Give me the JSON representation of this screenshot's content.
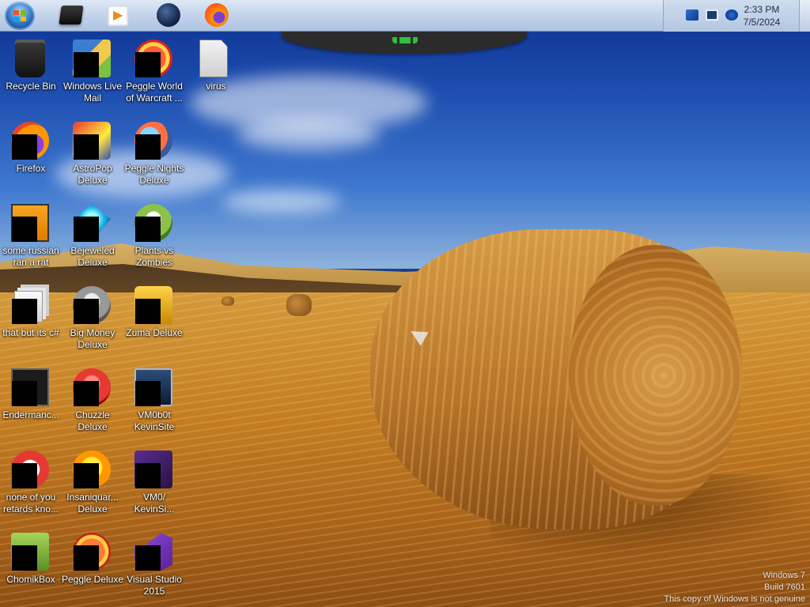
{
  "taskbar": {
    "pinned": [
      {
        "icon": "command-prompt-icon"
      },
      {
        "icon": "media-player-icon"
      },
      {
        "icon": "globe-browser-icon"
      },
      {
        "icon": "firefox-icon"
      }
    ],
    "tray_icons": [
      "action-center-flag-icon",
      "network-monitor-icon",
      "volume-icon"
    ],
    "clock": {
      "time": "2:33 PM",
      "date": "7/5/2024"
    }
  },
  "desktop": {
    "icons": [
      {
        "label": "Recycle Bin",
        "icon": "recycle-bin-icon"
      },
      {
        "label": "Windows Live Mail",
        "icon": "windows-live-mail-icon"
      },
      {
        "label": "Peggle World of Warcraft ...",
        "icon": "peggle-wow-icon"
      },
      {
        "label": "virus",
        "icon": "file-icon"
      },
      {
        "label": "Firefox",
        "icon": "firefox-icon"
      },
      {
        "label": "AstroPop Deluxe",
        "icon": "astropop-icon"
      },
      {
        "label": "Peggle Nights Deluxe",
        "icon": "peggle-nights-icon"
      },
      {
        "label": "some russian ran a rat",
        "icon": "program-icon"
      },
      {
        "label": "Bejeweled Deluxe",
        "icon": "bejeweled-icon"
      },
      {
        "label": "Plants vs Zombies",
        "icon": "plants-vs-zombies-icon"
      },
      {
        "label": "that but its c#",
        "icon": "files-icon"
      },
      {
        "label": "Big Money Deluxe",
        "icon": "big-money-icon"
      },
      {
        "label": "Zuma Deluxe",
        "icon": "zuma-icon"
      },
      {
        "label": "Endermanc...",
        "icon": "terminal-icon"
      },
      {
        "label": "Chuzzle Deluxe",
        "icon": "chuzzle-icon"
      },
      {
        "label": "VM0b0t KevinSite",
        "icon": "vm-monitor-icon"
      },
      {
        "label": "none of you retards kno...",
        "icon": "program-icon"
      },
      {
        "label": "Insaniquar... Deluxe",
        "icon": "insaniquarium-icon"
      },
      {
        "label": "VM0/ KevinSi...",
        "icon": "vm-icon"
      },
      {
        "label": "ChomikBox",
        "icon": "chomikbox-icon"
      },
      {
        "label": "Peggle Deluxe",
        "icon": "peggle-icon"
      },
      {
        "label": "Visual Studio 2015",
        "icon": "visual-studio-icon"
      }
    ]
  },
  "watermark": {
    "line1": "Windows 7",
    "line2": "Build 7601",
    "line3": "This copy of Windows is not genuine"
  }
}
